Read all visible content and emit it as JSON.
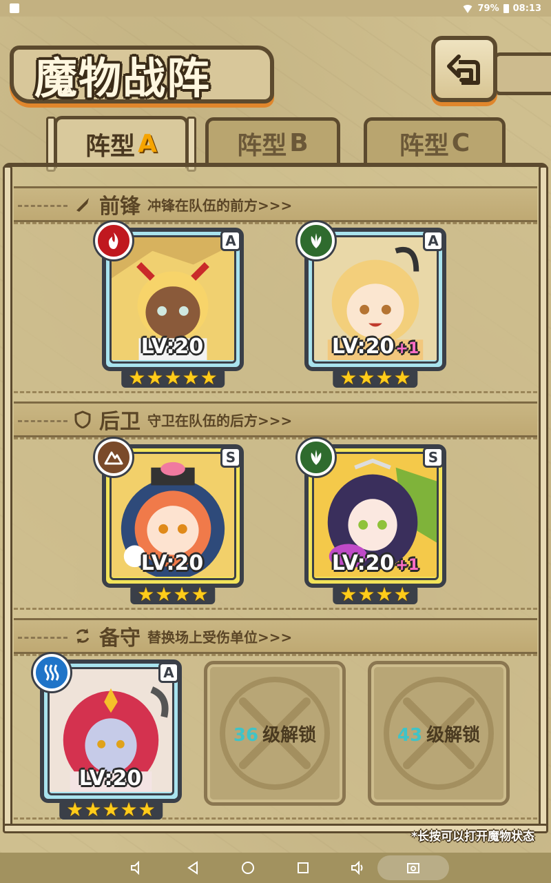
{
  "status_bar": {
    "battery": "79%",
    "time": "08:13"
  },
  "header": {
    "title": "魔物战阵"
  },
  "tabs": [
    {
      "label": "阵型",
      "letter": "A",
      "active": true
    },
    {
      "label": "阵型",
      "letter": "B",
      "active": false
    },
    {
      "label": "阵型",
      "letter": "C",
      "active": false
    }
  ],
  "sections": {
    "front": {
      "title": "前锋",
      "desc": "冲锋在队伍的前方>>>"
    },
    "back": {
      "title": "后卫",
      "desc": "守卫在队伍的后方>>>"
    },
    "reserve": {
      "title": "备守",
      "desc": "替换场上受伤单位>>>"
    }
  },
  "cards": [
    {
      "rank": "A",
      "level": "LV:20",
      "plus": "",
      "stars": 5,
      "element": "fire-icon",
      "element_color": "#c0181f"
    },
    {
      "rank": "A",
      "level": "LV:20",
      "plus": "+1",
      "stars": 4,
      "element": "leaf-icon",
      "element_color": "#2f6b2e"
    },
    {
      "rank": "S",
      "level": "LV:20",
      "plus": "",
      "stars": 4,
      "element": "mountain-icon",
      "element_color": "#7a4a2a"
    },
    {
      "rank": "S",
      "level": "LV:20",
      "plus": "+1",
      "stars": 4,
      "element": "leaf-icon",
      "element_color": "#2f6b2e"
    },
    {
      "rank": "A",
      "level": "LV:20",
      "plus": "",
      "stars": 5,
      "element": "water-icon",
      "element_color": "#1f74c8"
    }
  ],
  "locked_slots": [
    {
      "level": "36",
      "text": "级解锁"
    },
    {
      "level": "43",
      "text": "级解锁"
    }
  ],
  "hint": "*长按可以打开魔物状态",
  "colors": {
    "frame": "#5c4a2e",
    "accent_orange": "#e0862c",
    "star": "#ffcc1a",
    "unlock_num": "#3fc3c7"
  }
}
